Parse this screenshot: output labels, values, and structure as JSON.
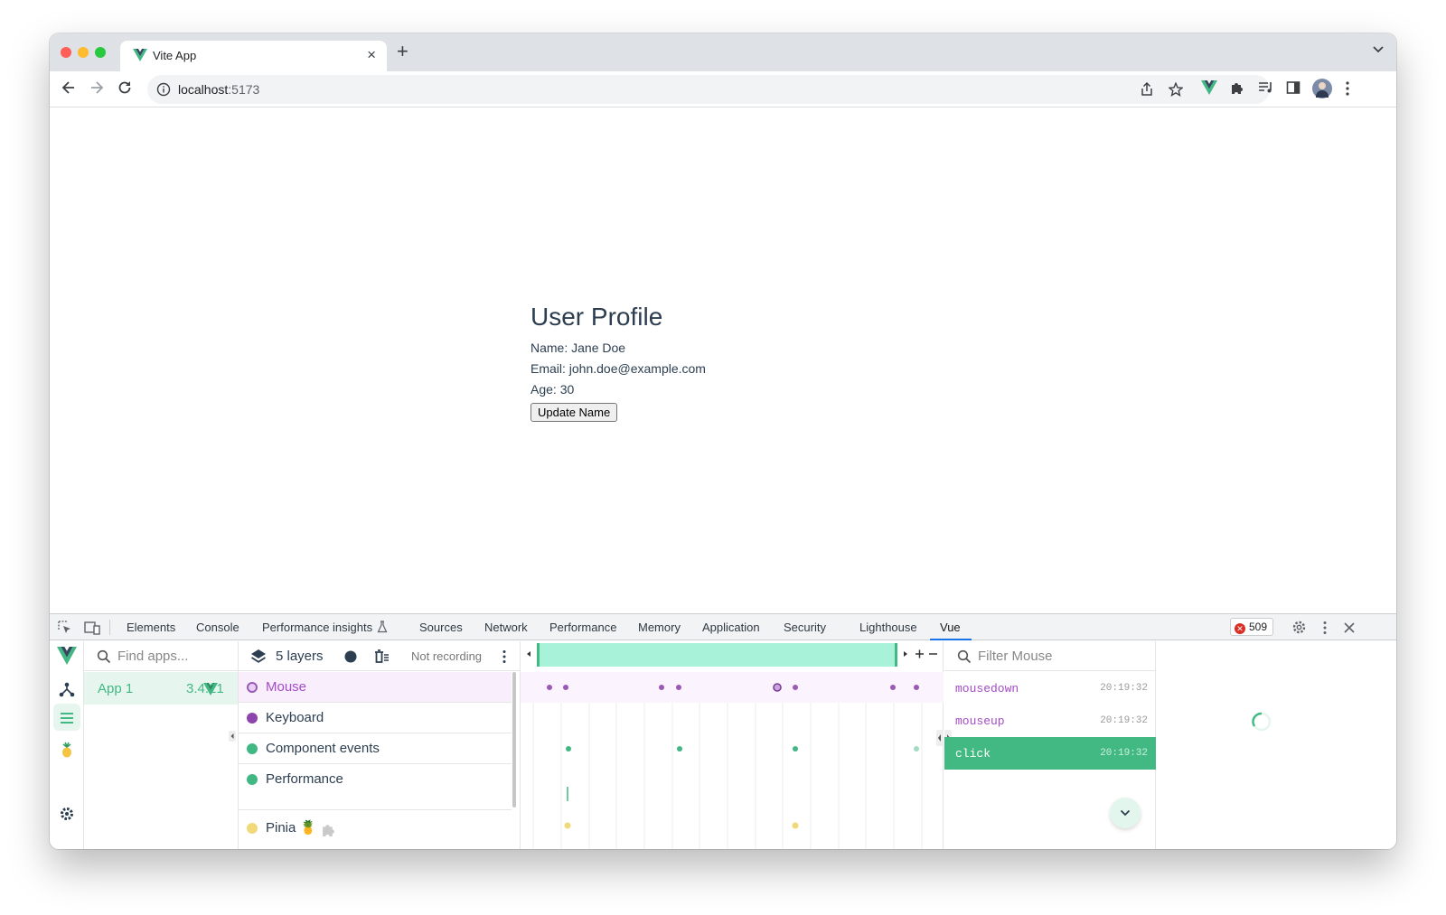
{
  "browser": {
    "tab_title": "Vite App",
    "tab_close": "×",
    "new_tab": "+",
    "url_host": "localhost",
    "url_port": ":5173"
  },
  "page": {
    "title": "User Profile",
    "name_line": "Name: Jane Doe",
    "email_line": "Email: john.doe@example.com",
    "age_line": "Age: 30",
    "button_label": "Update Name"
  },
  "devtools": {
    "tabs": [
      "Elements",
      "Console",
      "Performance insights",
      "Sources",
      "Network",
      "Performance",
      "Memory",
      "Application",
      "Security",
      "Lighthouse",
      "Vue"
    ],
    "active_tab": "Vue",
    "error_count": "509"
  },
  "vue": {
    "apps_search_placeholder": "Find apps...",
    "app_name": "App 1",
    "app_version": "3.4.21",
    "layers_label": "5 layers",
    "recording_status": "Not recording",
    "layers": [
      {
        "name": "Mouse",
        "color": "#9b59b6",
        "selected": true
      },
      {
        "name": "Keyboard",
        "color": "#8e44ad",
        "selected": false
      },
      {
        "name": "Component events",
        "color": "#41b883",
        "selected": false
      },
      {
        "name": "Performance",
        "color": "#41b883",
        "selected": false
      },
      {
        "name": "Pinia 🍍",
        "color": "#f1d97a",
        "selected": false
      }
    ],
    "events_filter_placeholder": "Filter Mouse",
    "events": [
      {
        "name": "mousedown",
        "time": "20:19:32",
        "selected": false
      },
      {
        "name": "mouseup",
        "time": "20:19:32",
        "selected": false
      },
      {
        "name": "click",
        "time": "20:19:32",
        "selected": true
      }
    ]
  },
  "colors": {
    "vue_green": "#42b883",
    "mouse_purple": "#a44cc7",
    "selected_row": "#42b883"
  }
}
